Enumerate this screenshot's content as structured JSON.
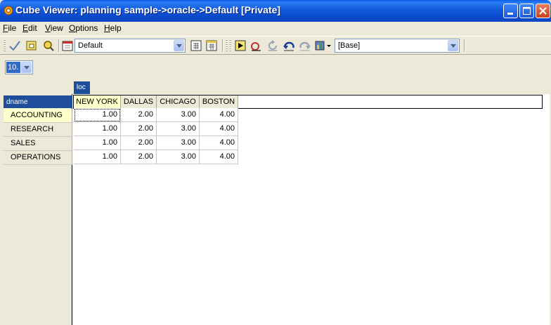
{
  "window": {
    "title": "Cube Viewer: planning sample->oracle->Default  [Private]"
  },
  "menu": [
    {
      "label": "File",
      "hot": "F",
      "rest": "ile"
    },
    {
      "label": "Edit",
      "hot": "E",
      "rest": "dit"
    },
    {
      "label": "View",
      "hot": "V",
      "rest": "iew"
    },
    {
      "label": "Options",
      "hot": "O",
      "rest": "ptions"
    },
    {
      "label": "Help",
      "hot": "H",
      "rest": "elp"
    }
  ],
  "toolbar": {
    "view_combo": "Default",
    "base_combo": "[Base]"
  },
  "page_selector": {
    "value": "10."
  },
  "column_dimension": "loc",
  "row_dimension": "dname",
  "grid": {
    "columns": [
      "NEW YORK",
      "DALLAS",
      "CHICAGO",
      "BOSTON"
    ],
    "rows": [
      {
        "label": "ACCOUNTING",
        "values": [
          "1.00",
          "2.00",
          "3.00",
          "4.00"
        ]
      },
      {
        "label": "RESEARCH",
        "values": [
          "1.00",
          "2.00",
          "3.00",
          "4.00"
        ]
      },
      {
        "label": "SALES",
        "values": [
          "1.00",
          "2.00",
          "3.00",
          "4.00"
        ]
      },
      {
        "label": "OPERATIONS",
        "values": [
          "1.00",
          "2.00",
          "3.00",
          "4.00"
        ]
      }
    ]
  },
  "colors": {
    "titlebar": "#0a48cc",
    "dim_tab": "#1e4e9a",
    "active_header": "#ffffcc"
  }
}
